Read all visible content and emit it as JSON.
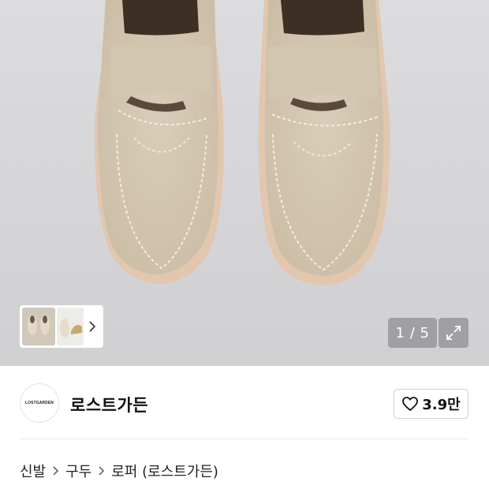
{
  "gallery": {
    "counter": "1 / 5",
    "current_image": 1,
    "total_images": 5,
    "thumbnails": [
      {
        "name": "thumbnail-1",
        "active": true
      },
      {
        "name": "thumbnail-2",
        "active": false
      }
    ]
  },
  "brand": {
    "logo_text": "LOSTGARDEN",
    "name": "로스트가든"
  },
  "like": {
    "count": "3.9만"
  },
  "breadcrumb": [
    "신발",
    "구두",
    "로퍼 (로스트가든)"
  ],
  "colors": {
    "gallery_bg": "#d6d6d8",
    "suede": "#d4c7b2",
    "sole": "#d9b9a2"
  },
  "icons": {
    "expand": "expand-icon",
    "heart": "heart-icon",
    "chevron": "chevron-right-icon"
  }
}
